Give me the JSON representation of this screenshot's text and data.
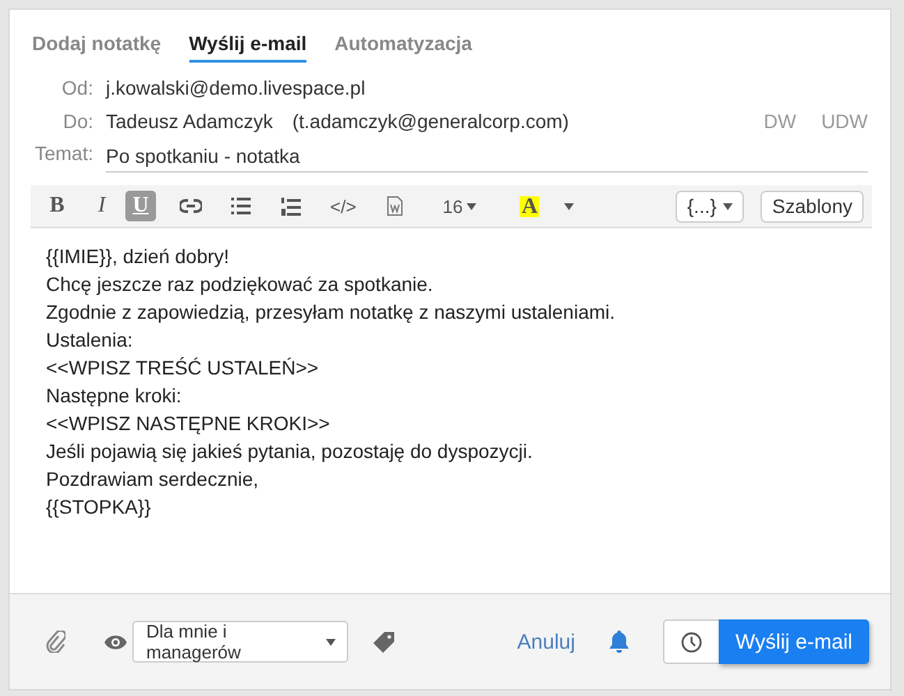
{
  "tabs": [
    {
      "label": "Dodaj notatkę",
      "selected": false
    },
    {
      "label": "Wyślij e-mail",
      "selected": true
    },
    {
      "label": "Automatyzacja",
      "selected": false
    }
  ],
  "fields": [
    {
      "label": "Od:",
      "value": "j.kowalski@demo.livespace.pl"
    },
    {
      "label": "Do:",
      "value": "Tadeusz Adamczyk",
      "email": "(t.adamczyk@generalcorp.com)"
    },
    {
      "label": "Temat:",
      "value": "Po spotkaniu - notatka"
    }
  ],
  "cc_links": [
    "DW",
    "UDW"
  ],
  "toolbar": [
    {
      "kind": "bold",
      "label": "B",
      "active": false
    },
    {
      "kind": "italic",
      "label": "I",
      "active": false
    },
    {
      "kind": "underline",
      "label": "U",
      "active": true
    },
    {
      "kind": "link",
      "active": false
    },
    {
      "kind": "bullets",
      "active": false
    },
    {
      "kind": "numbers",
      "active": false
    },
    {
      "kind": "code",
      "label": "</>",
      "active": false
    },
    {
      "kind": "word",
      "active": false
    },
    {
      "kind": "size",
      "label": "16",
      "active": false
    },
    {
      "kind": "highlight",
      "label": "A",
      "active": false
    }
  ],
  "variables_button": "{...}",
  "templates_button": "Szablony",
  "body_lines": [
    "{{IMIE}}, dzień dobry!",
    "Chcę jeszcze raz podziękować za spotkanie.",
    "Zgodnie z zapowiedzią, przesyłam notatkę z naszymi ustaleniami.",
    "Ustalenia:",
    "<<WPISZ TREŚĆ USTALEŃ>>",
    "Następne kroki:",
    "<<WPISZ NASTĘPNE KROKI>>",
    "Jeśli pojawią się jakieś pytania, pozostaję do dyspozycji.",
    "Pozdrawiam serdecznie,",
    "{{STOPKA}}"
  ],
  "footer": {
    "visibility": "Dla mnie i managerów",
    "cancel": "Anuluj",
    "send": "Wyślij e-mail"
  }
}
